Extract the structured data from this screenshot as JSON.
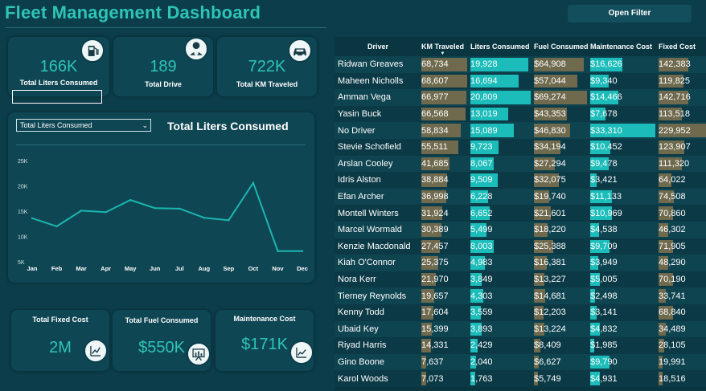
{
  "title": "Fleet Management Dashboard",
  "filter_button": "Open Filter",
  "kpis": [
    {
      "value": "166K",
      "label": "Total Liters Consumed",
      "icon": "fuel-pump-icon"
    },
    {
      "value": "189",
      "label": "Total Drive",
      "icon": "driver-icon"
    },
    {
      "value": "722K",
      "label": "Total KM Traveled",
      "icon": "car-icon"
    }
  ],
  "chart": {
    "dropdown": "Total Liters Consumed",
    "title": "Total Liters Consumed"
  },
  "chart_data": {
    "type": "line",
    "categories": [
      "Jan",
      "Feb",
      "Mar",
      "Apr",
      "May",
      "Jun",
      "Jul",
      "Aug",
      "Sep",
      "Oct",
      "Nov",
      "Dec"
    ],
    "values": [
      13600,
      12000,
      15100,
      14800,
      17200,
      15600,
      15500,
      13700,
      13200,
      20600,
      7100,
      7100
    ],
    "yticks": [
      "25K",
      "20K",
      "15K",
      "10K",
      "5K"
    ],
    "ylim": [
      5000,
      25000
    ],
    "color": "#1bb6b0"
  },
  "bottom_cards": [
    {
      "label": "Total Fixed Cost",
      "value": "2M",
      "icon": "growth-chart-icon"
    },
    {
      "label": "Total Fuel Consumed",
      "value": "$550K",
      "icon": "presentation-chart-icon"
    },
    {
      "label": "Maintenance Cost",
      "value": "$171K",
      "icon": "line-chart-icon"
    }
  ],
  "table": {
    "columns": [
      "Driver",
      "KM Traveled",
      "Liters Consumed",
      "Fuel Consumed",
      "Maintenance Cost",
      "Fixed Cost"
    ],
    "sort_indicator": "▼",
    "rows": [
      {
        "driver": "Ridwan Greaves",
        "km": "68,734",
        "liters": "19,928",
        "fuel": "$64,908",
        "maint": "$16,626",
        "fixed": "142,383"
      },
      {
        "driver": "Maheen Nicholls",
        "km": "68,607",
        "liters": "16,694",
        "fuel": "$57,044",
        "maint": "$9,340",
        "fixed": "119,825"
      },
      {
        "driver": "Amman Vega",
        "km": "66,977",
        "liters": "20,809",
        "fuel": "$69,274",
        "maint": "$14,466",
        "fixed": "142,716"
      },
      {
        "driver": "Yasin Buck",
        "km": "66,568",
        "liters": "13,019",
        "fuel": "$43,353",
        "maint": "$7,678",
        "fixed": "113,518"
      },
      {
        "driver": "No Driver",
        "km": "58,834",
        "liters": "15,089",
        "fuel": "$46,830",
        "maint": "$33,310",
        "fixed": "229,952"
      },
      {
        "driver": "Stevie Schofield",
        "km": "55,511",
        "liters": "9,723",
        "fuel": "$34,194",
        "maint": "$10,452",
        "fixed": "123,907"
      },
      {
        "driver": "Arslan Cooley",
        "km": "41,685",
        "liters": "8,067",
        "fuel": "$27,294",
        "maint": "$9,478",
        "fixed": "111,320"
      },
      {
        "driver": "Idris Alston",
        "km": "38,884",
        "liters": "9,509",
        "fuel": "$32,075",
        "maint": "$3,421",
        "fixed": "64,022"
      },
      {
        "driver": "Efan Archer",
        "km": "36,998",
        "liters": "6,228",
        "fuel": "$19,740",
        "maint": "$11,133",
        "fixed": "74,508"
      },
      {
        "driver": "Montell Winters",
        "km": "31,924",
        "liters": "6,652",
        "fuel": "$21,601",
        "maint": "$10,969",
        "fixed": "70,860"
      },
      {
        "driver": "Marcel Wormald",
        "km": "30,389",
        "liters": "5,499",
        "fuel": "$18,220",
        "maint": "$4,538",
        "fixed": "46,302"
      },
      {
        "driver": "Kenzie Macdonald",
        "km": "27,457",
        "liters": "8,003",
        "fuel": "$25,388",
        "maint": "$9,709",
        "fixed": "71,905"
      },
      {
        "driver": "Kiah O'Connor",
        "km": "25,375",
        "liters": "4,983",
        "fuel": "$16,381",
        "maint": "$3,949",
        "fixed": "48,290"
      },
      {
        "driver": "Nora Kerr",
        "km": "21,970",
        "liters": "3,849",
        "fuel": "$13,227",
        "maint": "$5,005",
        "fixed": "70,190"
      },
      {
        "driver": "Tierney Reynolds",
        "km": "19,657",
        "liters": "4,303",
        "fuel": "$14,681",
        "maint": "$2,498",
        "fixed": "33,741"
      },
      {
        "driver": "Kenny Todd",
        "km": "17,604",
        "liters": "3,559",
        "fuel": "$12,203",
        "maint": "$3,141",
        "fixed": "68,840"
      },
      {
        "driver": "Ubaid Key",
        "km": "15,399",
        "liters": "3,893",
        "fuel": "$13,224",
        "maint": "$4,832",
        "fixed": "34,489"
      },
      {
        "driver": "Riyad Harris",
        "km": "14,331",
        "liters": "2,429",
        "fuel": "$8,409",
        "maint": "$1,985",
        "fixed": "28,105"
      },
      {
        "driver": "Gino Boone",
        "km": "7,637",
        "liters": "2,040",
        "fuel": "$6,627",
        "maint": "$9,790",
        "fixed": "19,991"
      },
      {
        "driver": "Karol Woods",
        "km": "7,073",
        "liters": "1,763",
        "fuel": "$5,749",
        "maint": "$4,931",
        "fixed": "18,516"
      }
    ]
  }
}
